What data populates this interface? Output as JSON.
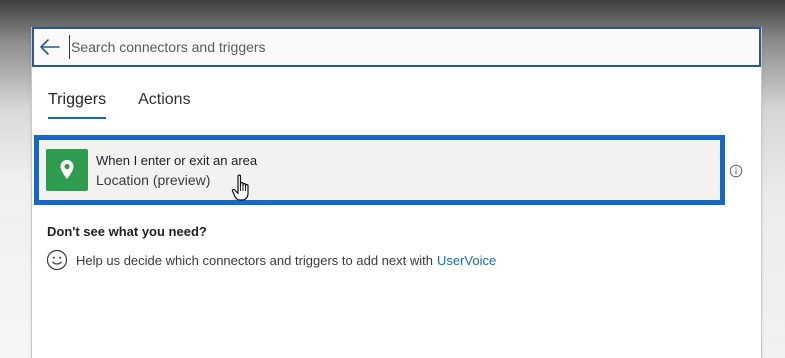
{
  "search": {
    "placeholder": "Search connectors and triggers"
  },
  "tabs": [
    {
      "label": "Triggers",
      "active": true
    },
    {
      "label": "Actions",
      "active": false
    }
  ],
  "trigger": {
    "title": "When I enter or exit an area",
    "subtitle": "Location (preview)",
    "icon": "location-pin-icon",
    "icon_color": "#2e9c4e",
    "highlight_color": "#1767c4"
  },
  "help": {
    "heading": "Don't see what you need?",
    "text": "Help us decide which connectors and triggers to add next with",
    "link": "UserVoice"
  },
  "colors": {
    "accent": "#0f6cbd",
    "search_border": "#2b5797"
  }
}
